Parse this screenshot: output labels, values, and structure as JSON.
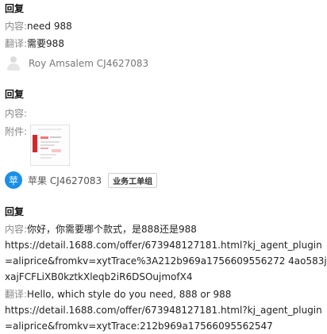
{
  "messages": [
    {
      "title": "回复",
      "content_label": "内容:",
      "content": "need 988",
      "translate_label": "翻译:",
      "translation": "需要988",
      "sender": "Roy Amsalem CJ4627083"
    },
    {
      "title": "回复",
      "content_label": "内容:",
      "content": "",
      "attachment_label": "附件:",
      "sender_avatar": "苹",
      "sender": "苹果 CJ4627083",
      "badge": "业务工单组"
    },
    {
      "title": "回复",
      "content_label": "内容:",
      "content": "你好，你需要哪个款式，是888还是988",
      "content_link": "https://detail.1688.com/offer/673948127181.html?kj_agent_plugin=aliprice&fromkv=xytTrace%3A212b969a1756609556272 4ao583jxajFCFLiXB0kztkXleqb2iR6DSOujmofX4",
      "translate_label": "翻译:",
      "translation": "Hello, which style do you need, 888 or 988",
      "translation_link": "https://detail.1688.com/offer/673948127181.html?kj_agent_plugin=aliprice&fromkv=xytTrace:212b969a17566095562547"
    }
  ]
}
